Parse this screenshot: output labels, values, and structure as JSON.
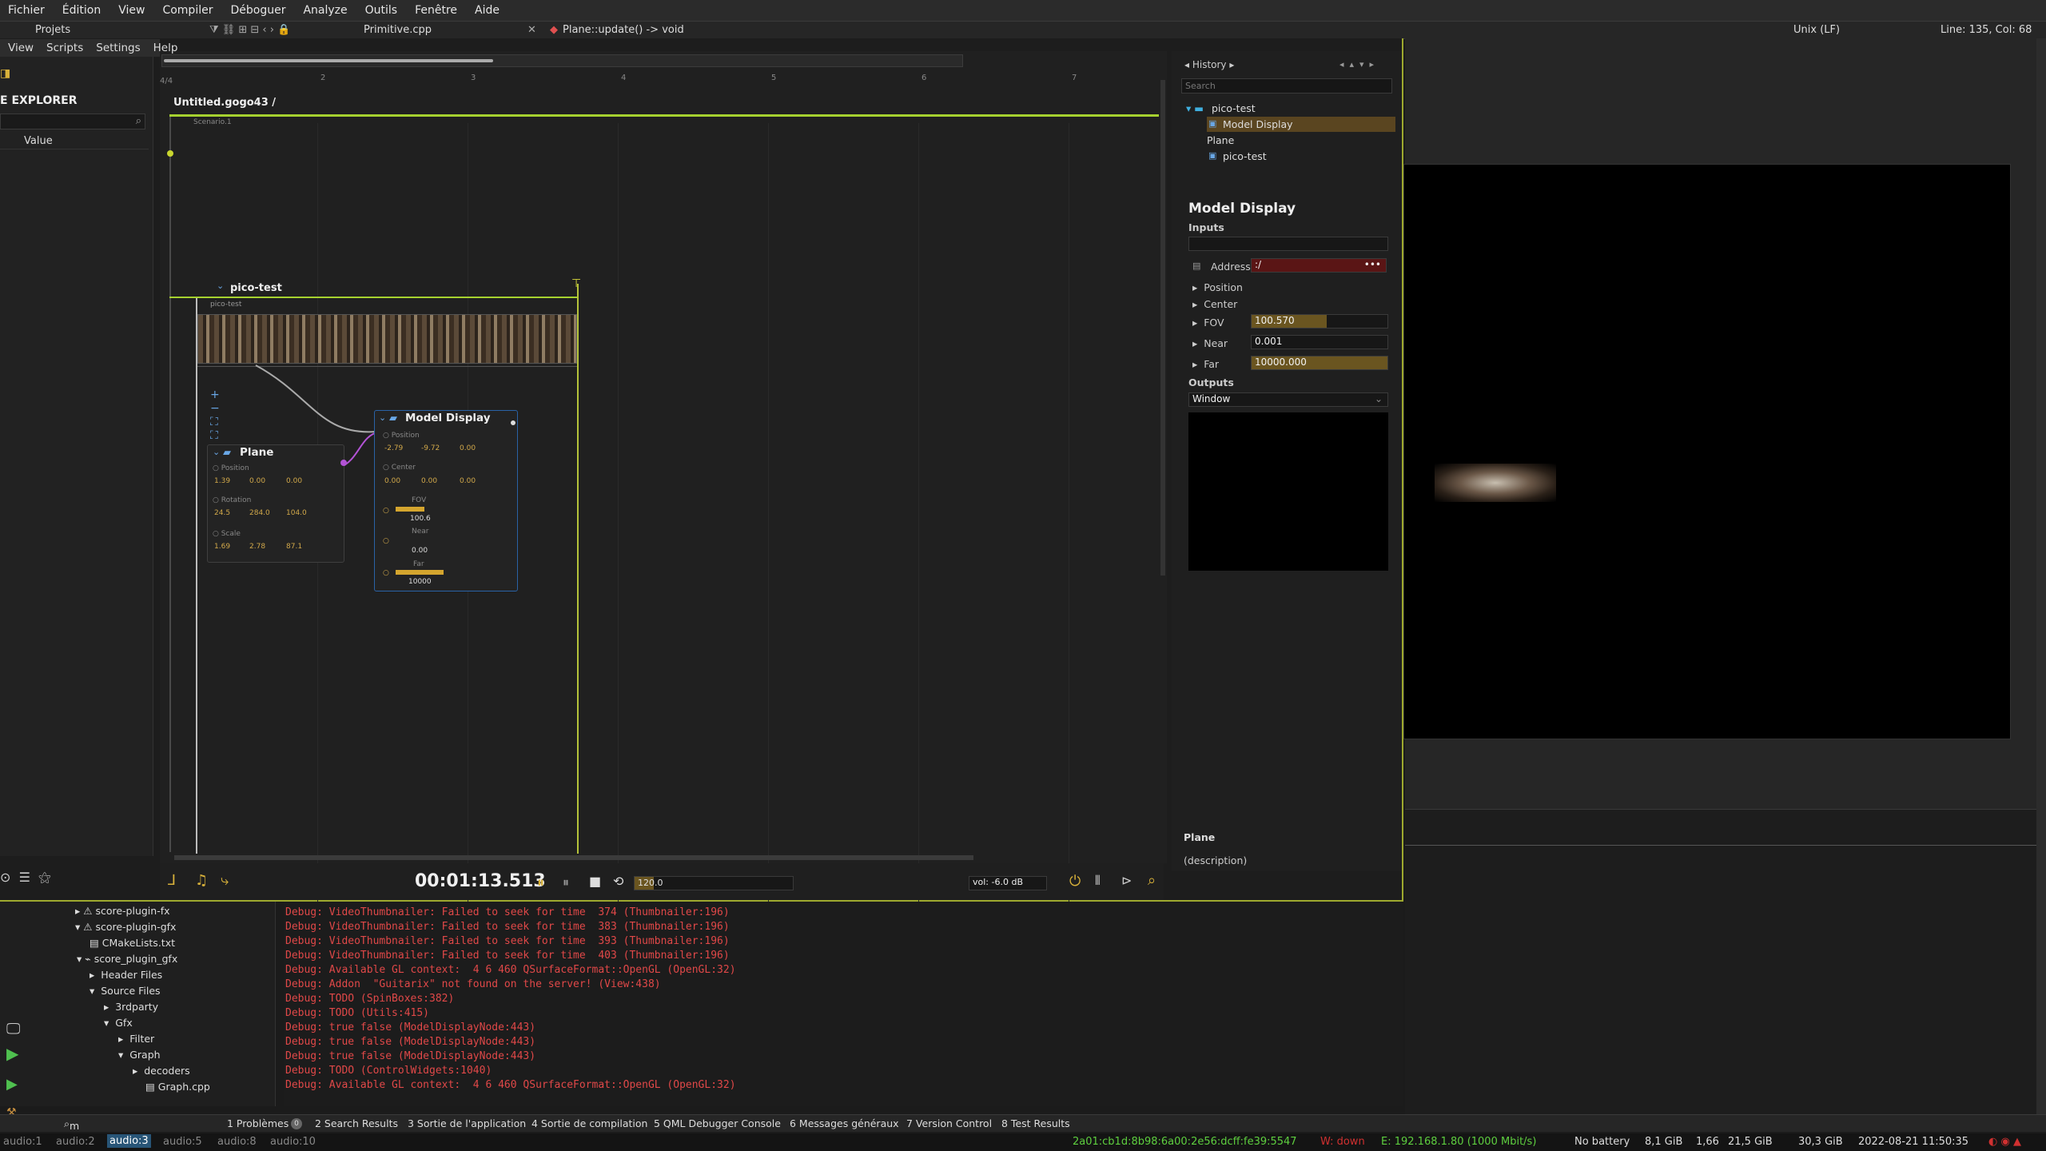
{
  "menu": [
    "Fichier",
    "Édition",
    "View",
    "Compiler",
    "Déboguer",
    "Analyze",
    "Outils",
    "Fenêtre",
    "Aide"
  ],
  "toolbar": {
    "projects": "Projets",
    "file": "Primitive.cpp",
    "function": "Plane::update() -> void",
    "line_ending": "Unix (LF)",
    "position": "Line: 135, Col: 68"
  },
  "score_menu": [
    "View",
    "Scripts",
    "Settings",
    "Help"
  ],
  "explorer": {
    "title": "E EXPLORER",
    "value_header": "Value"
  },
  "timeline": {
    "time_signature": "4/4",
    "ruler": [
      "2",
      "3",
      "4",
      "5",
      "6",
      "7"
    ],
    "document": "Untitled.gogo43 /",
    "scenario": "Scenario.1",
    "process": "pico-test",
    "film_label": "pico-test"
  },
  "plane_node": {
    "title": "Plane",
    "position_label": "Position",
    "position": [
      "1.39",
      "0.00",
      "0.00"
    ],
    "rotation_label": "Rotation",
    "rotation": [
      "24.5",
      "284.0",
      "104.0"
    ],
    "scale_label": "Scale",
    "scale": [
      "1.69",
      "2.78",
      "87.1"
    ]
  },
  "model_node": {
    "title": "Model Display",
    "position_label": "Position",
    "position": [
      "-2.79",
      "-9.72",
      "0.00"
    ],
    "center_label": "Center",
    "center": [
      "0.00",
      "0.00",
      "0.00"
    ],
    "fov_label": "FOV",
    "fov": "100.6",
    "near_label": "Near",
    "near": "0.00",
    "far_label": "Far",
    "far": "10000"
  },
  "transport": {
    "time": "00:01:13.513",
    "tempo": "120.0",
    "tempo_fraction": 0.12,
    "volume": "vol: -6.0 dB"
  },
  "inspector": {
    "history_label": "History",
    "search_placeholder": "Search",
    "tree": [
      "pico-test",
      "Model Display",
      "Plane",
      "pico-test"
    ],
    "title": "Model Display",
    "inputs_label": "Inputs",
    "address_label": "Address",
    "address_value": ":/",
    "position_label": "Position",
    "center_label": "Center",
    "fov_label": "FOV",
    "fov_value": "100.570",
    "fov_fraction": 0.55,
    "near_label": "Near",
    "near_value": "0.001",
    "far_label": "Far",
    "far_value": "10000.000",
    "far_fraction": 1.0,
    "outputs_label": "Outputs",
    "window_option": "Window",
    "bottom_title": "Plane",
    "bottom_desc": "(description)"
  },
  "project_tree": [
    "score-plugin-fx",
    "score-plugin-gfx",
    "CMakeLists.txt",
    "score_plugin_gfx",
    "Header Files",
    "Source Files",
    "3rdparty",
    "Gfx",
    "Filter",
    "Graph",
    "decoders",
    "Graph.cpp"
  ],
  "console": [
    "Debug: VideoThumbnailer: Failed to seek for time  374 (Thumbnailer:196)",
    "Debug: VideoThumbnailer: Failed to seek for time  383 (Thumbnailer:196)",
    "Debug: VideoThumbnailer: Failed to seek for time  393 (Thumbnailer:196)",
    "Debug: VideoThumbnailer: Failed to seek for time  403 (Thumbnailer:196)",
    "Debug: Available GL context:  4 6 460 QSurfaceFormat::OpenGL (OpenGL:32)",
    "Debug: Addon  \"Guitarix\" not found on the server! (View:438)",
    "Debug: TODO (SpinBoxes:382)",
    "Debug: TODO (Utils:415)",
    "Debug: true false (ModelDisplayNode:443)",
    "Debug: true false (ModelDisplayNode:443)",
    "Debug: true false (ModelDisplayNode:443)",
    "Debug: TODO (ControlWidgets:1040)",
    "Debug: Available GL context:  4 6 460 QSurfaceFormat::OpenGL (OpenGL:32)"
  ],
  "tabs": {
    "locator": "m load_geometr",
    "items": [
      "1  Problèmes",
      "2  Search Results",
      "3  Sortie de l'application",
      "4  Sortie de compilation",
      "5  QML Debugger Console",
      "6  Messages généraux",
      "7  Version Control",
      "8  Test Results"
    ],
    "problems_badge": "0"
  },
  "status": {
    "workspaces": [
      "audio:1",
      "audio:2",
      "audio:3",
      "audio:5",
      "audio:8",
      "audio:10"
    ],
    "active_workspace": "audio:3",
    "ipv6": "2a01:cb1d:8b98:6a00:2e56:dcff:fe39:5547",
    "wifi": "W: down",
    "ethernet": "E: 192.168.1.80 (1000 Mbit/s)",
    "battery": "No battery",
    "mem": "8,1 GiB",
    "load": "1,66",
    "disk": "21,5 GiB",
    "disk2": "30,3 GiB",
    "datetime": "2022-08-21 11:50:35"
  }
}
